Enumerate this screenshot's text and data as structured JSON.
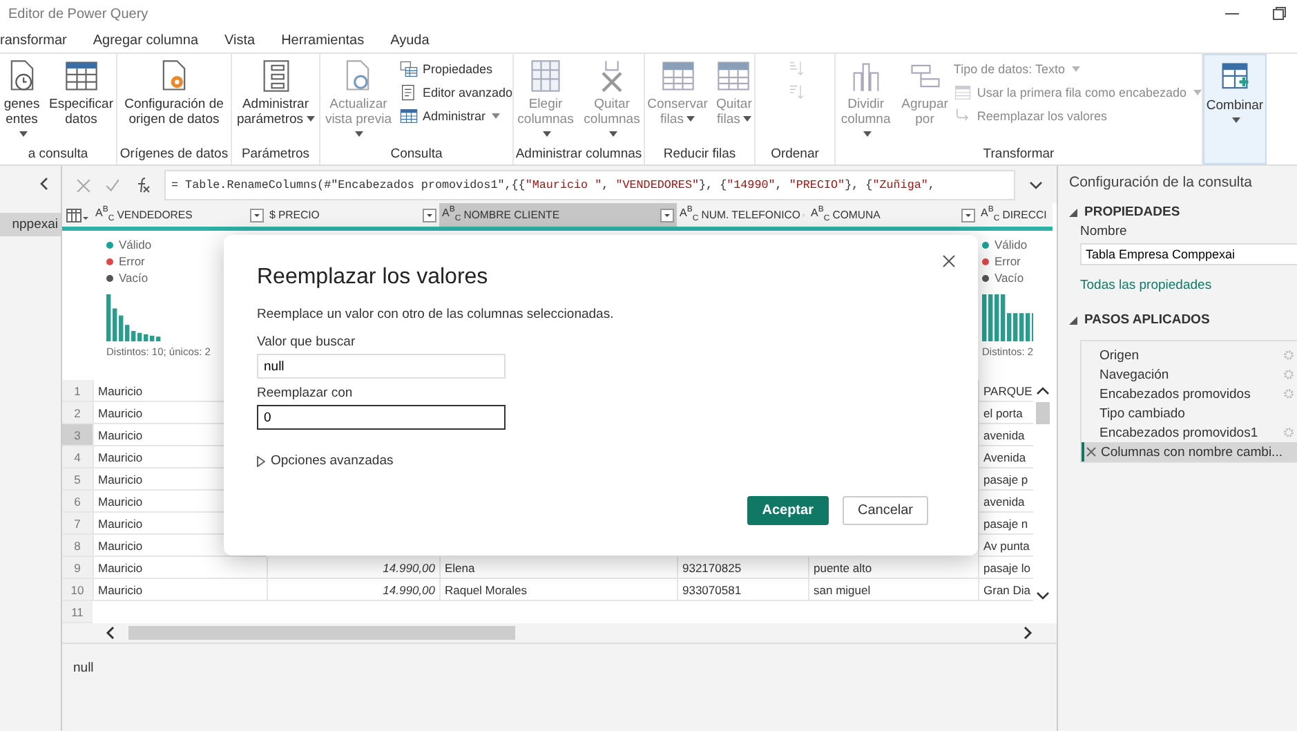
{
  "window": {
    "title": "Editor de Power Query"
  },
  "menu_tabs": [
    "ransformar",
    "Agregar columna",
    "Vista",
    "Herramientas",
    "Ayuda"
  ],
  "ribbon": {
    "groups": [
      {
        "label": "a consulta",
        "items": [
          {
            "kind": "large",
            "label": "genes\nentes",
            "dropdown": true,
            "disabled": false
          },
          {
            "kind": "large",
            "label": "Especificar\ndatos",
            "dropdown": false,
            "disabled": false
          }
        ]
      },
      {
        "label": "Orígenes de datos",
        "items": [
          {
            "kind": "large",
            "label": "Configuración de\norigen de datos",
            "dropdown": false,
            "disabled": false
          }
        ]
      },
      {
        "label": "Parámetros",
        "items": [
          {
            "kind": "large",
            "label": "Administrar\nparámetros",
            "dropdown": true,
            "disabled": false
          }
        ]
      },
      {
        "label": "Consulta",
        "items": [
          {
            "kind": "large",
            "label": "Actualizar\nvista previa",
            "dropdown": true,
            "disabled": true
          },
          {
            "kind": "stack",
            "items": [
              {
                "label": "Propiedades",
                "dropdown": false,
                "disabled": false
              },
              {
                "label": "Editor avanzado",
                "dropdown": false,
                "disabled": false
              },
              {
                "label": "Administrar",
                "dropdown": true,
                "disabled": false
              }
            ]
          }
        ]
      },
      {
        "label": "Administrar columnas",
        "items": [
          {
            "kind": "large",
            "label": "Elegir\ncolumnas",
            "dropdown": true,
            "disabled": true
          },
          {
            "kind": "large",
            "label": "Quitar\ncolumnas",
            "dropdown": true,
            "disabled": true
          }
        ]
      },
      {
        "label": "Reducir filas",
        "items": [
          {
            "kind": "large",
            "label": "Conservar\nfilas",
            "dropdown": true,
            "disabled": true
          },
          {
            "kind": "large",
            "label": "Quitar\nfilas",
            "dropdown": true,
            "disabled": true
          }
        ]
      },
      {
        "label": "Ordenar",
        "items": [
          {
            "kind": "stack",
            "items": [
              {
                "disabled": true
              },
              {
                "disabled": true
              }
            ]
          }
        ]
      },
      {
        "label": "Transformar",
        "items": [
          {
            "kind": "large",
            "label": "Dividir\ncolumna",
            "dropdown": true,
            "disabled": true
          },
          {
            "kind": "large",
            "label": "Agrupar\npor",
            "dropdown": false,
            "disabled": true
          },
          {
            "kind": "stack",
            "items": [
              {
                "label": "Tipo de datos: Texto",
                "dropdown": true,
                "disabled": true
              },
              {
                "label": "Usar la primera fila como encabezado",
                "dropdown": true,
                "disabled": true
              },
              {
                "label": "Reemplazar los valores",
                "dropdown": false,
                "disabled": true
              }
            ]
          }
        ]
      },
      {
        "items": [
          {
            "kind": "large",
            "label": "Combinar",
            "dropdown": true,
            "disabled": false
          }
        ]
      }
    ]
  },
  "queries_panel": {
    "items": [
      {
        "label": "nppexai",
        "selected": true
      }
    ]
  },
  "formula": [
    {
      "kind": "code",
      "text": "= Table.RenameColumns(#\"Encabezados promovidos1\",{{"
    },
    {
      "kind": "string",
      "text": "\"Mauricio \""
    },
    {
      "kind": "code",
      "text": ", "
    },
    {
      "kind": "string",
      "text": "\"VENDEDORES\""
    },
    {
      "kind": "code",
      "text": "}, {"
    },
    {
      "kind": "string",
      "text": "\"14990\""
    },
    {
      "kind": "code",
      "text": ", "
    },
    {
      "kind": "string",
      "text": "\"PRECIO\""
    },
    {
      "kind": "code",
      "text": "}, {"
    },
    {
      "kind": "string",
      "text": "\"Zuñiga\""
    },
    {
      "kind": "code",
      "text": ","
    }
  ],
  "table": {
    "columns": [
      {
        "name": "VENDEDORES",
        "type_icon": "A$^{B}$$_{C}$",
        "selected": false,
        "profile": {
          "legend": [
            {
              "label": "Válido",
              "color": "#1aa39a"
            },
            {
              "label": "Error",
              "color": "#e0474c"
            },
            {
              "label": "Vacío",
              "color": "#555555"
            }
          ],
          "summary": "Distintos: 10; únicos: 2"
        }
      },
      {
        "name": "PRECIO",
        "type_icon": "$",
        "selected": false
      },
      {
        "name": "NOMBRE CLIENTE",
        "type_icon": "A$^{B}$$_{C}$",
        "selected": true
      },
      {
        "name": "NUM. TELEFONICO",
        "type_icon": "A$^{B}$$_{C}$",
        "selected": false
      },
      {
        "name": "COMUNA",
        "type_icon": "A$^{B}$$_{C}$",
        "selected": false
      },
      {
        "name": "DIRECCI",
        "type_icon": "A$^{B}$$_{C}$",
        "selected": false,
        "profile": {
          "legend": [
            {
              "label": "Válido",
              "color": "#1aa39a"
            },
            {
              "label": "Error",
              "color": "#e0474c"
            },
            {
              "label": "Vacío",
              "color": "#555555"
            }
          ],
          "summary": "Distintos: 2"
        }
      }
    ],
    "rows": [
      {
        "number": "1",
        "selected": false,
        "vendedores": "Mauricio",
        "direccion": "PARQUE"
      },
      {
        "number": "2",
        "selected": false,
        "vendedores": "Mauricio",
        "direccion": "el porta"
      },
      {
        "number": "3",
        "selected": true,
        "vendedores": "Mauricio",
        "direccion": "avenida"
      },
      {
        "number": "4",
        "selected": false,
        "vendedores": "Mauricio",
        "direccion": "Avenida"
      },
      {
        "number": "5",
        "selected": false,
        "vendedores": "Mauricio",
        "direccion": "pasaje p"
      },
      {
        "number": "6",
        "selected": false,
        "vendedores": "Mauricio",
        "direccion": "avenida"
      },
      {
        "number": "7",
        "selected": false,
        "vendedores": "Mauricio",
        "direccion": "pasaje n"
      },
      {
        "number": "8",
        "selected": false,
        "vendedores": "Mauricio",
        "direccion": "Av punta"
      },
      {
        "number": "9",
        "selected": false,
        "vendedores": "Mauricio",
        "precio": "14.990,00",
        "nombre_cliente": "Elena",
        "num_telefonico": "932170825",
        "comuna": "puente alto",
        "direccion": "pasaje lo"
      },
      {
        "number": "10",
        "selected": false,
        "vendedores": "Mauricio",
        "precio": "14.990,00",
        "nombre_cliente": "Raquel Morales",
        "num_telefonico": "933070581",
        "comuna": "san miguel",
        "direccion": "Gran Dia"
      },
      {
        "number": "11",
        "selected": false
      }
    ]
  },
  "preview": {
    "value": "null"
  },
  "dialog": {
    "title": "Reemplazar los valores",
    "description": "Reemplace un valor con otro de las columnas seleccionadas.",
    "fields": [
      {
        "label": "Valor que buscar",
        "value": "null",
        "focused": false
      },
      {
        "label": "Reemplazar con",
        "value": "0",
        "focused": true
      }
    ],
    "advanced": {
      "label": "Opciones avanzadas",
      "expanded": false
    },
    "buttons": [
      {
        "label": "Aceptar",
        "primary": true
      },
      {
        "label": "Cancelar",
        "primary": false
      }
    ]
  },
  "query_settings": {
    "title": "Configuración de la consulta",
    "properties": {
      "heading": "PROPIEDADES",
      "expanded": true,
      "name_label": "Nombre",
      "name_value": "Tabla Empresa Comppexai",
      "all_link": "Todas las propiedades"
    },
    "steps_heading": "PASOS APLICADOS",
    "steps_expanded": true,
    "steps": [
      {
        "label": "Origen",
        "settings": true,
        "selected": false
      },
      {
        "label": "Navegación",
        "settings": true,
        "selected": false
      },
      {
        "label": "Encabezados promovidos",
        "settings": true,
        "selected": false
      },
      {
        "label": "Tipo cambiado",
        "settings": false,
        "selected": false
      },
      {
        "label": "Encabezados promovidos1",
        "settings": true,
        "selected": false
      },
      {
        "label": "Columnas con nombre cambi...",
        "settings": false,
        "selected": true
      }
    ]
  }
}
